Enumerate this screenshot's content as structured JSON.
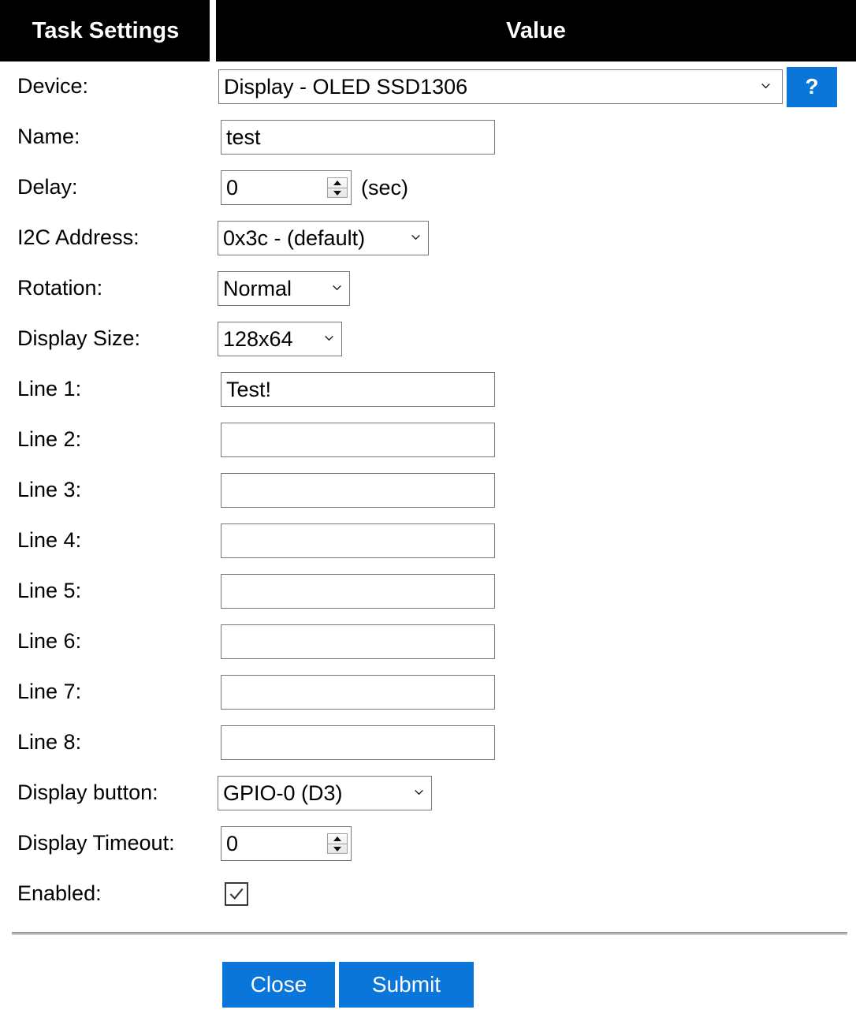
{
  "header": {
    "col_settings": "Task Settings",
    "col_value": "Value"
  },
  "form": {
    "device": {
      "label": "Device:",
      "value": "Display - OLED SSD1306",
      "help_label": "?"
    },
    "name": {
      "label": "Name:",
      "value": "test",
      "placeholder": ""
    },
    "delay": {
      "label": "Delay:",
      "value": "0",
      "unit": "(sec)"
    },
    "i2c_address": {
      "label": "I2C Address:",
      "value": "0x3c - (default)"
    },
    "rotation": {
      "label": "Rotation:",
      "value": "Normal"
    },
    "display_size": {
      "label": "Display Size:",
      "value": "128x64"
    },
    "lines": [
      {
        "label": "Line 1:",
        "value": "Test!"
      },
      {
        "label": "Line 2:",
        "value": ""
      },
      {
        "label": "Line 3:",
        "value": ""
      },
      {
        "label": "Line 4:",
        "value": ""
      },
      {
        "label": "Line 5:",
        "value": ""
      },
      {
        "label": "Line 6:",
        "value": ""
      },
      {
        "label": "Line 7:",
        "value": ""
      },
      {
        "label": "Line 8:",
        "value": ""
      }
    ],
    "display_button": {
      "label": "Display button:",
      "value": "GPIO-0 (D3)"
    },
    "display_timeout": {
      "label": "Display Timeout:",
      "value": "0"
    },
    "enabled": {
      "label": "Enabled:",
      "checked": true
    }
  },
  "footer": {
    "close_label": "Close",
    "submit_label": "Submit"
  },
  "colors": {
    "header_bg": "#000000",
    "header_fg": "#ffffff",
    "accent_blue": "#0b76d9",
    "field_border": "#767676",
    "rule_gray": "#8e8e8e"
  }
}
